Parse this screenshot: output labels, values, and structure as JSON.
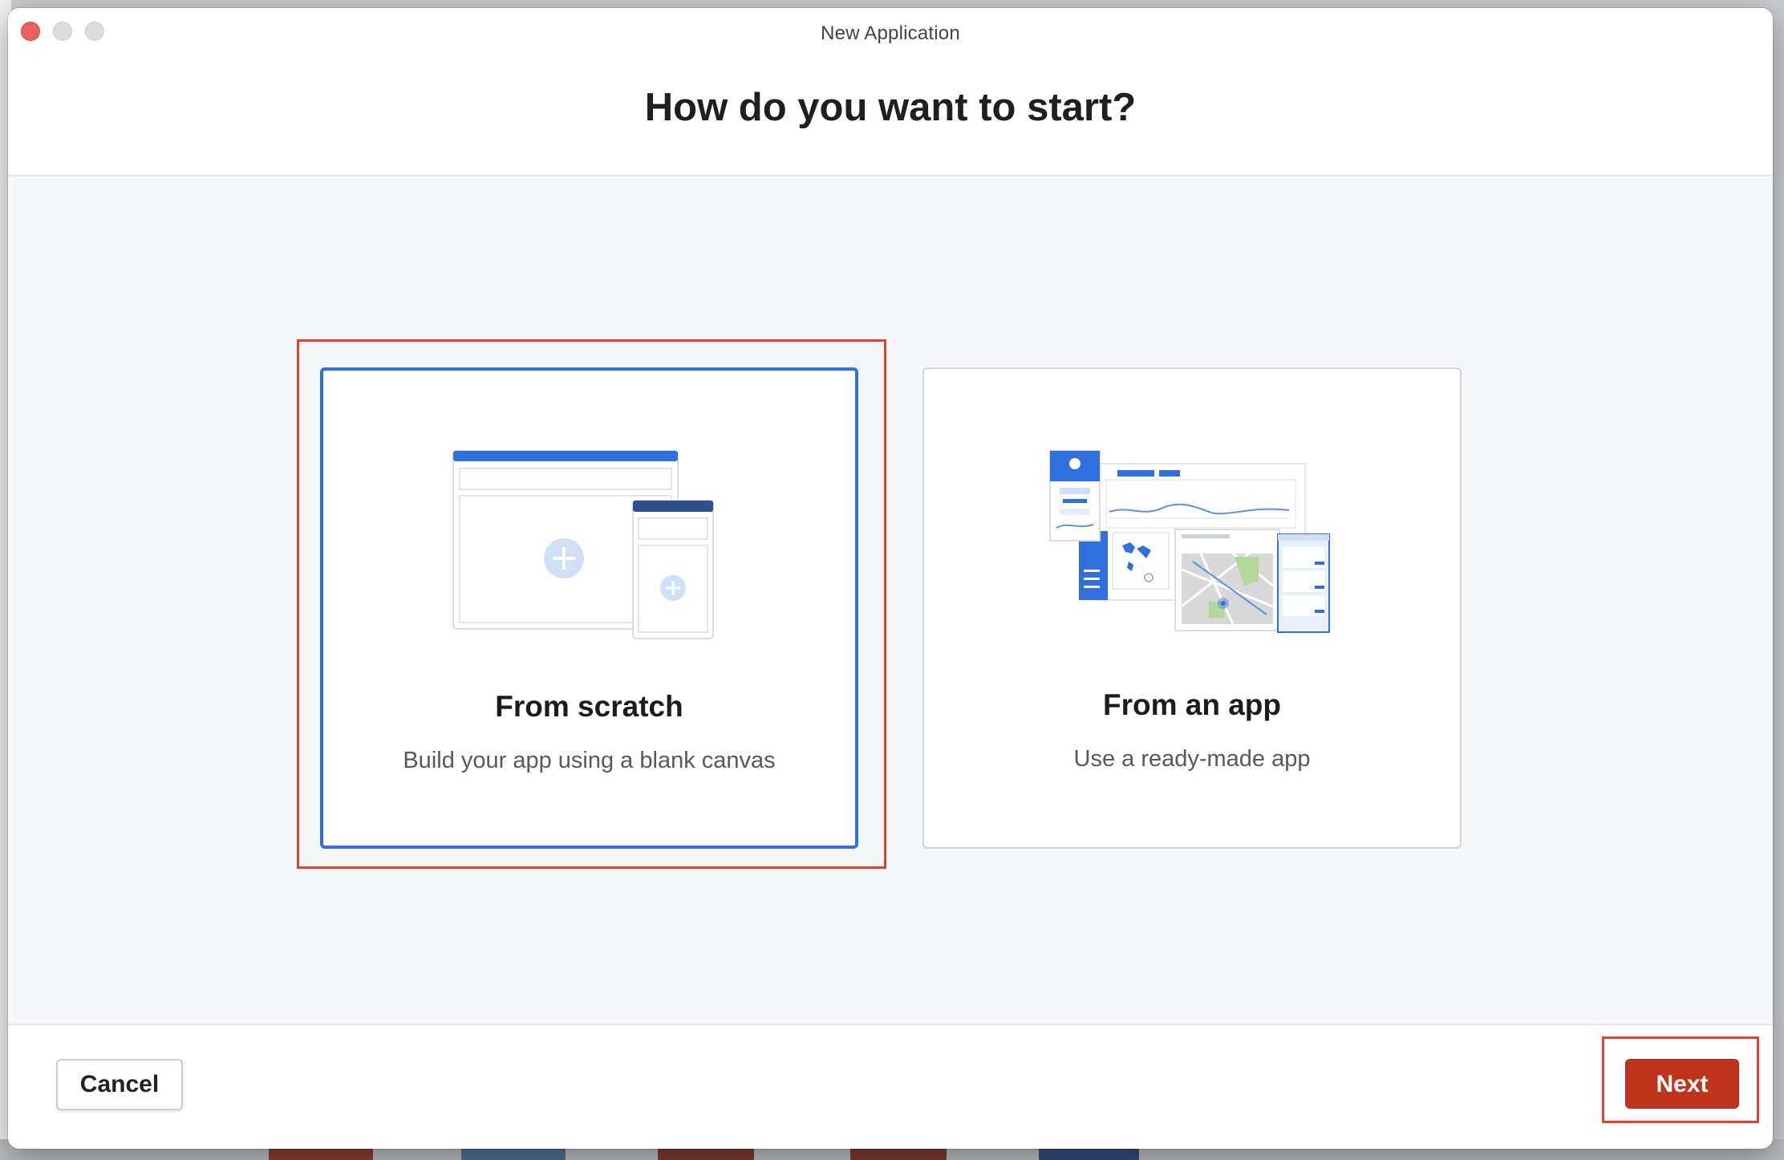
{
  "window": {
    "title": "New Application"
  },
  "header": {
    "heading": "How do you want to start?"
  },
  "options": [
    {
      "title": "From scratch",
      "description": "Build your app using a blank canvas",
      "selected": true,
      "icon": "blank-canvas-icon"
    },
    {
      "title": "From an app",
      "description": "Use a ready-made app",
      "selected": false,
      "icon": "dashboard-template-icon"
    }
  ],
  "footer": {
    "cancel_label": "Cancel",
    "next_label": "Next"
  },
  "colors": {
    "accent": "#2f6fde",
    "primary_button": "#c0341d",
    "highlight_box": "#e0432f",
    "content_bg": "#f6f7f9"
  }
}
